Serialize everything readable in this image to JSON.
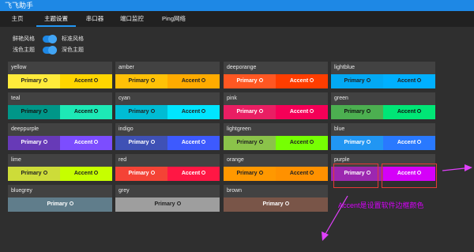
{
  "app": {
    "title": "飞飞助手"
  },
  "tabs": [
    {
      "label": "主页"
    },
    {
      "label": "主题设置"
    },
    {
      "label": "串口器"
    },
    {
      "label": "端口监控"
    },
    {
      "label": "Ping网络"
    }
  ],
  "toggles": [
    {
      "left": "鲜艳风格",
      "right": "标准风格"
    },
    {
      "left": "浅色主题",
      "right": "深色主题"
    }
  ],
  "swatches": [
    {
      "name": "yellow",
      "primary_label": "Primary",
      "accent_label": "Accent",
      "primary_color": "#ffeb3b",
      "accent_color": "#ffd600",
      "text_color": "#222222"
    },
    {
      "name": "amber",
      "primary_label": "Primary",
      "accent_label": "Accent",
      "primary_color": "#ffc107",
      "accent_color": "#ffab00",
      "text_color": "#222222"
    },
    {
      "name": "deeporange",
      "primary_label": "Primary",
      "accent_label": "Accent",
      "primary_color": "#ff5722",
      "accent_color": "#ff3d00",
      "text_color": "#ffffff"
    },
    {
      "name": "lightblue",
      "primary_label": "Primary",
      "accent_label": "Accent",
      "primary_color": "#03a9f4",
      "accent_color": "#00b0ff",
      "text_color": "#222222"
    },
    {
      "name": "teal",
      "primary_label": "Primary",
      "accent_label": "Accent",
      "primary_color": "#009688",
      "accent_color": "#1de9b6",
      "text_color": "#111111"
    },
    {
      "name": "cyan",
      "primary_label": "Primary",
      "accent_label": "Accent",
      "primary_color": "#00bcd4",
      "accent_color": "#00e5ff",
      "text_color": "#222222"
    },
    {
      "name": "pink",
      "primary_label": "Primary",
      "accent_label": "Accent",
      "primary_color": "#e91e63",
      "accent_color": "#f50057",
      "text_color": "#ffffff"
    },
    {
      "name": "green",
      "primary_label": "Primary",
      "accent_label": "Accent",
      "primary_color": "#4caf50",
      "accent_color": "#00e676",
      "text_color": "#111111"
    },
    {
      "name": "deeppurple",
      "primary_label": "Primary",
      "accent_label": "Accent",
      "primary_color": "#673ab7",
      "accent_color": "#7c4dff",
      "text_color": "#ffffff"
    },
    {
      "name": "indigo",
      "primary_label": "Primary",
      "accent_label": "Accent",
      "primary_color": "#3f51b5",
      "accent_color": "#3d5afe",
      "text_color": "#ffffff"
    },
    {
      "name": "lightgreen",
      "primary_label": "Primary",
      "accent_label": "Accent",
      "primary_color": "#8bc34a",
      "accent_color": "#76ff03",
      "text_color": "#222222"
    },
    {
      "name": "blue",
      "primary_label": "Primary",
      "accent_label": "Accent",
      "primary_color": "#2196f3",
      "accent_color": "#2979ff",
      "text_color": "#ffffff"
    },
    {
      "name": "lime",
      "primary_label": "Primary",
      "accent_label": "Accent",
      "primary_color": "#cddc39",
      "accent_color": "#c6ff00",
      "text_color": "#222222"
    },
    {
      "name": "red",
      "primary_label": "Primary",
      "accent_label": "Accent",
      "primary_color": "#f44336",
      "accent_color": "#ff1744",
      "text_color": "#ffffff"
    },
    {
      "name": "orange",
      "primary_label": "Primary",
      "accent_label": "Accent",
      "primary_color": "#ff9800",
      "accent_color": "#ff9100",
      "text_color": "#222222"
    },
    {
      "name": "purple",
      "primary_label": "Primary",
      "accent_label": "Accent",
      "primary_color": "#9c27b0",
      "accent_color": "#d500f9",
      "text_color": "#ffffff"
    },
    {
      "name": "bluegrey",
      "primary_label": "Primary",
      "primary_color": "#607d8b",
      "text_color": "#ffffff"
    },
    {
      "name": "grey",
      "primary_label": "Primary",
      "primary_color": "#9e9e9e",
      "text_color": "#222222"
    },
    {
      "name": "brown",
      "primary_label": "Primary",
      "primary_color": "#795548",
      "text_color": "#ffffff"
    }
  ],
  "annotation": {
    "text": "Accent是设置软件边框颜色",
    "color": "#d500f9"
  }
}
